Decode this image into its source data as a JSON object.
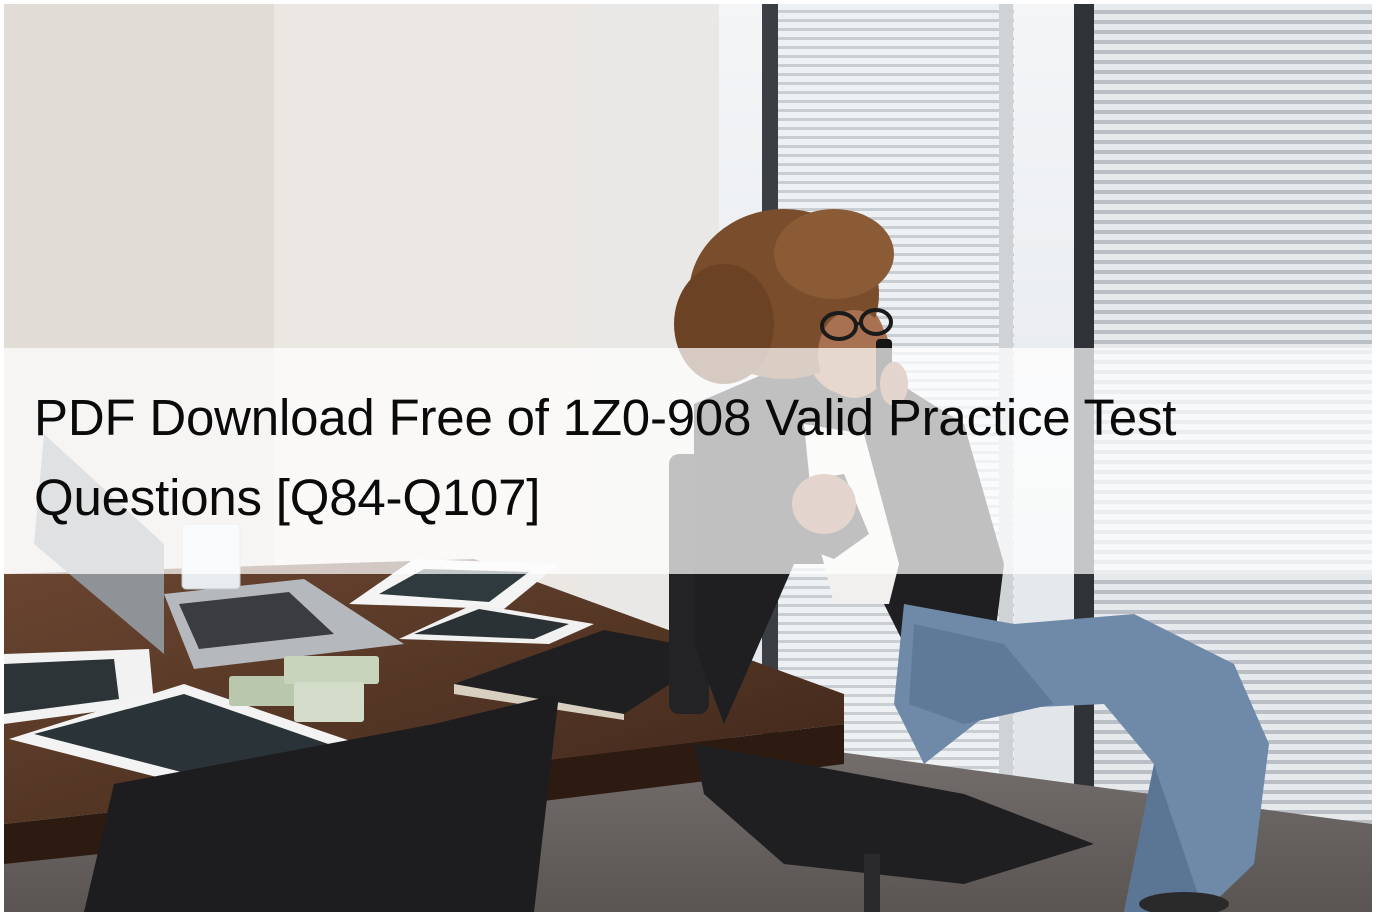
{
  "banner": {
    "title": "PDF Download Free of 1Z0-908 Valid Practice Test Questions [Q84-Q107]"
  },
  "colors": {
    "wall": "#e9e6e2",
    "window_light": "#eef1f4",
    "table_wood": "#5a3a28",
    "jacket": "#1f1f22",
    "jeans": "#6f8aa8",
    "hair": "#7a4e2c",
    "carpet": "#6e6966",
    "banner_overlay": "rgba(255,255,255,0.72)",
    "title_text": "#0a0a0a"
  },
  "icons": []
}
